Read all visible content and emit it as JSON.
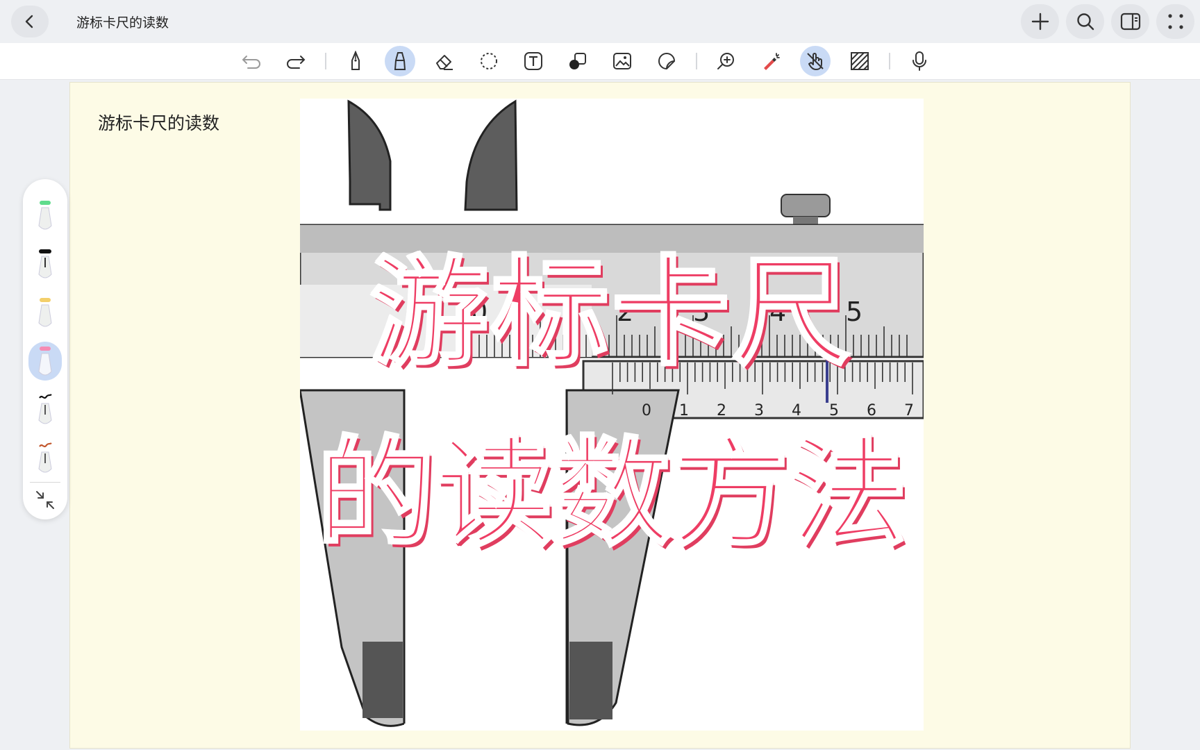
{
  "header": {
    "title": "游标卡尺的读数"
  },
  "note": {
    "title": "游标卡尺的读数"
  },
  "overlay": {
    "line1": "游标卡尺",
    "line2": "的读数方法"
  },
  "main_scale_labels": [
    "0",
    "2",
    "3",
    "4",
    "5"
  ],
  "vernier_scale_labels": [
    "0",
    "1",
    "2",
    "3",
    "4",
    "5",
    "6",
    "7"
  ],
  "colors": {
    "accent": "#c9daf5",
    "page": "#fdfbe6",
    "overlay": "#ee3d64"
  },
  "toolbar_icons": [
    "undo-icon",
    "redo-icon",
    "pen-icon",
    "marker-icon",
    "eraser-icon",
    "lasso-icon",
    "text-icon",
    "shape-icon",
    "image-icon",
    "sticker-icon",
    "zoom-icon",
    "laser-pointer-icon",
    "hand-touch-icon",
    "hatch-icon",
    "microphone-icon"
  ],
  "pens": [
    "green-marker",
    "black-pen",
    "yellow-marker",
    "pink-marker",
    "black-brush",
    "brown-brush"
  ]
}
